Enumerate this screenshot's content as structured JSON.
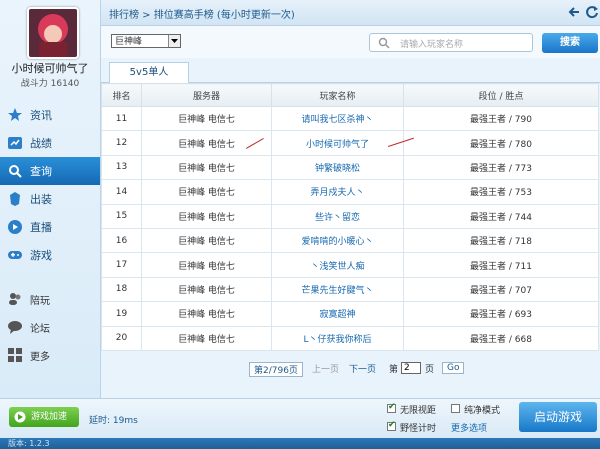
{
  "profile": {
    "username": "小时候可帅气了",
    "power_label": "战斗力 16140"
  },
  "nav": [
    {
      "label": "资讯",
      "icon": "star-icon"
    },
    {
      "label": "战绩",
      "icon": "chart-icon"
    },
    {
      "label": "查询",
      "icon": "search-icon",
      "active": true
    },
    {
      "label": "出装",
      "icon": "armor-icon"
    },
    {
      "label": "直播",
      "icon": "play-icon"
    },
    {
      "label": "游戏",
      "icon": "gamepad-icon"
    }
  ],
  "nav_secondary": [
    {
      "label": "陪玩",
      "icon": "people-icon"
    },
    {
      "label": "论坛",
      "icon": "chat-icon"
    },
    {
      "label": "更多",
      "icon": "grid-icon"
    }
  ],
  "header": {
    "breadcrumb": "排行榜 > 排位赛高手榜 (每小时更新一次)"
  },
  "toolbar": {
    "server_select": "巨神峰",
    "search_placeholder": "请输入玩家名称",
    "search_button": "搜索"
  },
  "tab": {
    "label": "5v5单人"
  },
  "table": {
    "headers": [
      "排名",
      "服务器",
      "玩家名称",
      "段位 / 胜点"
    ],
    "rows": [
      [
        "11",
        "巨神峰 电信七",
        "请叫我七区杀神丶",
        "最强王者 / 790"
      ],
      [
        "12",
        "巨神峰 电信七",
        "小时候可帅气了",
        "最强王者 / 780"
      ],
      [
        "13",
        "巨神峰 电信七",
        "钟繁破晓松",
        "最强王者 / 773"
      ],
      [
        "14",
        "巨神峰 电信七",
        "弄月戍夫人丶",
        "最强王者 / 753"
      ],
      [
        "15",
        "巨神峰 电信七",
        "些许丶留恋",
        "最强王者 / 744"
      ],
      [
        "16",
        "巨神峰 电信七",
        "爱啃啃的小暖心丶",
        "最强王者 / 718"
      ],
      [
        "17",
        "巨神峰 电信七",
        "丶浅笑世人痴",
        "最强王者 / 711"
      ],
      [
        "18",
        "巨神峰 电信七",
        "芒果先生好腱气丶",
        "最强王者 / 707"
      ],
      [
        "19",
        "巨神峰 电信七",
        "寂寞超神",
        "最强王者 / 693"
      ],
      [
        "20",
        "巨神峰 电信七",
        "L丶仔获我你称后",
        "最强王者 / 668"
      ]
    ]
  },
  "pager": {
    "summary": "第2/796页",
    "prev": "上一页",
    "next": "下一页",
    "goto_prefix": "第",
    "page_value": "2",
    "goto_suffix": "页",
    "go": "Go"
  },
  "footer": {
    "accelerate": "游戏加速",
    "latency": "延时: 19ms",
    "opt_unlimited": "无限视距",
    "opt_pure": "纯净模式",
    "opt_timer": "野怪计时",
    "more_options": "更多选项",
    "launch": "启动游戏"
  },
  "statusbar": {
    "version": "版本: 1.2.3"
  },
  "colors": {
    "accent": "#1a75c8",
    "active_nav": "#1669b4",
    "player_link": "#1668b0",
    "arrow": "#c0282c"
  }
}
